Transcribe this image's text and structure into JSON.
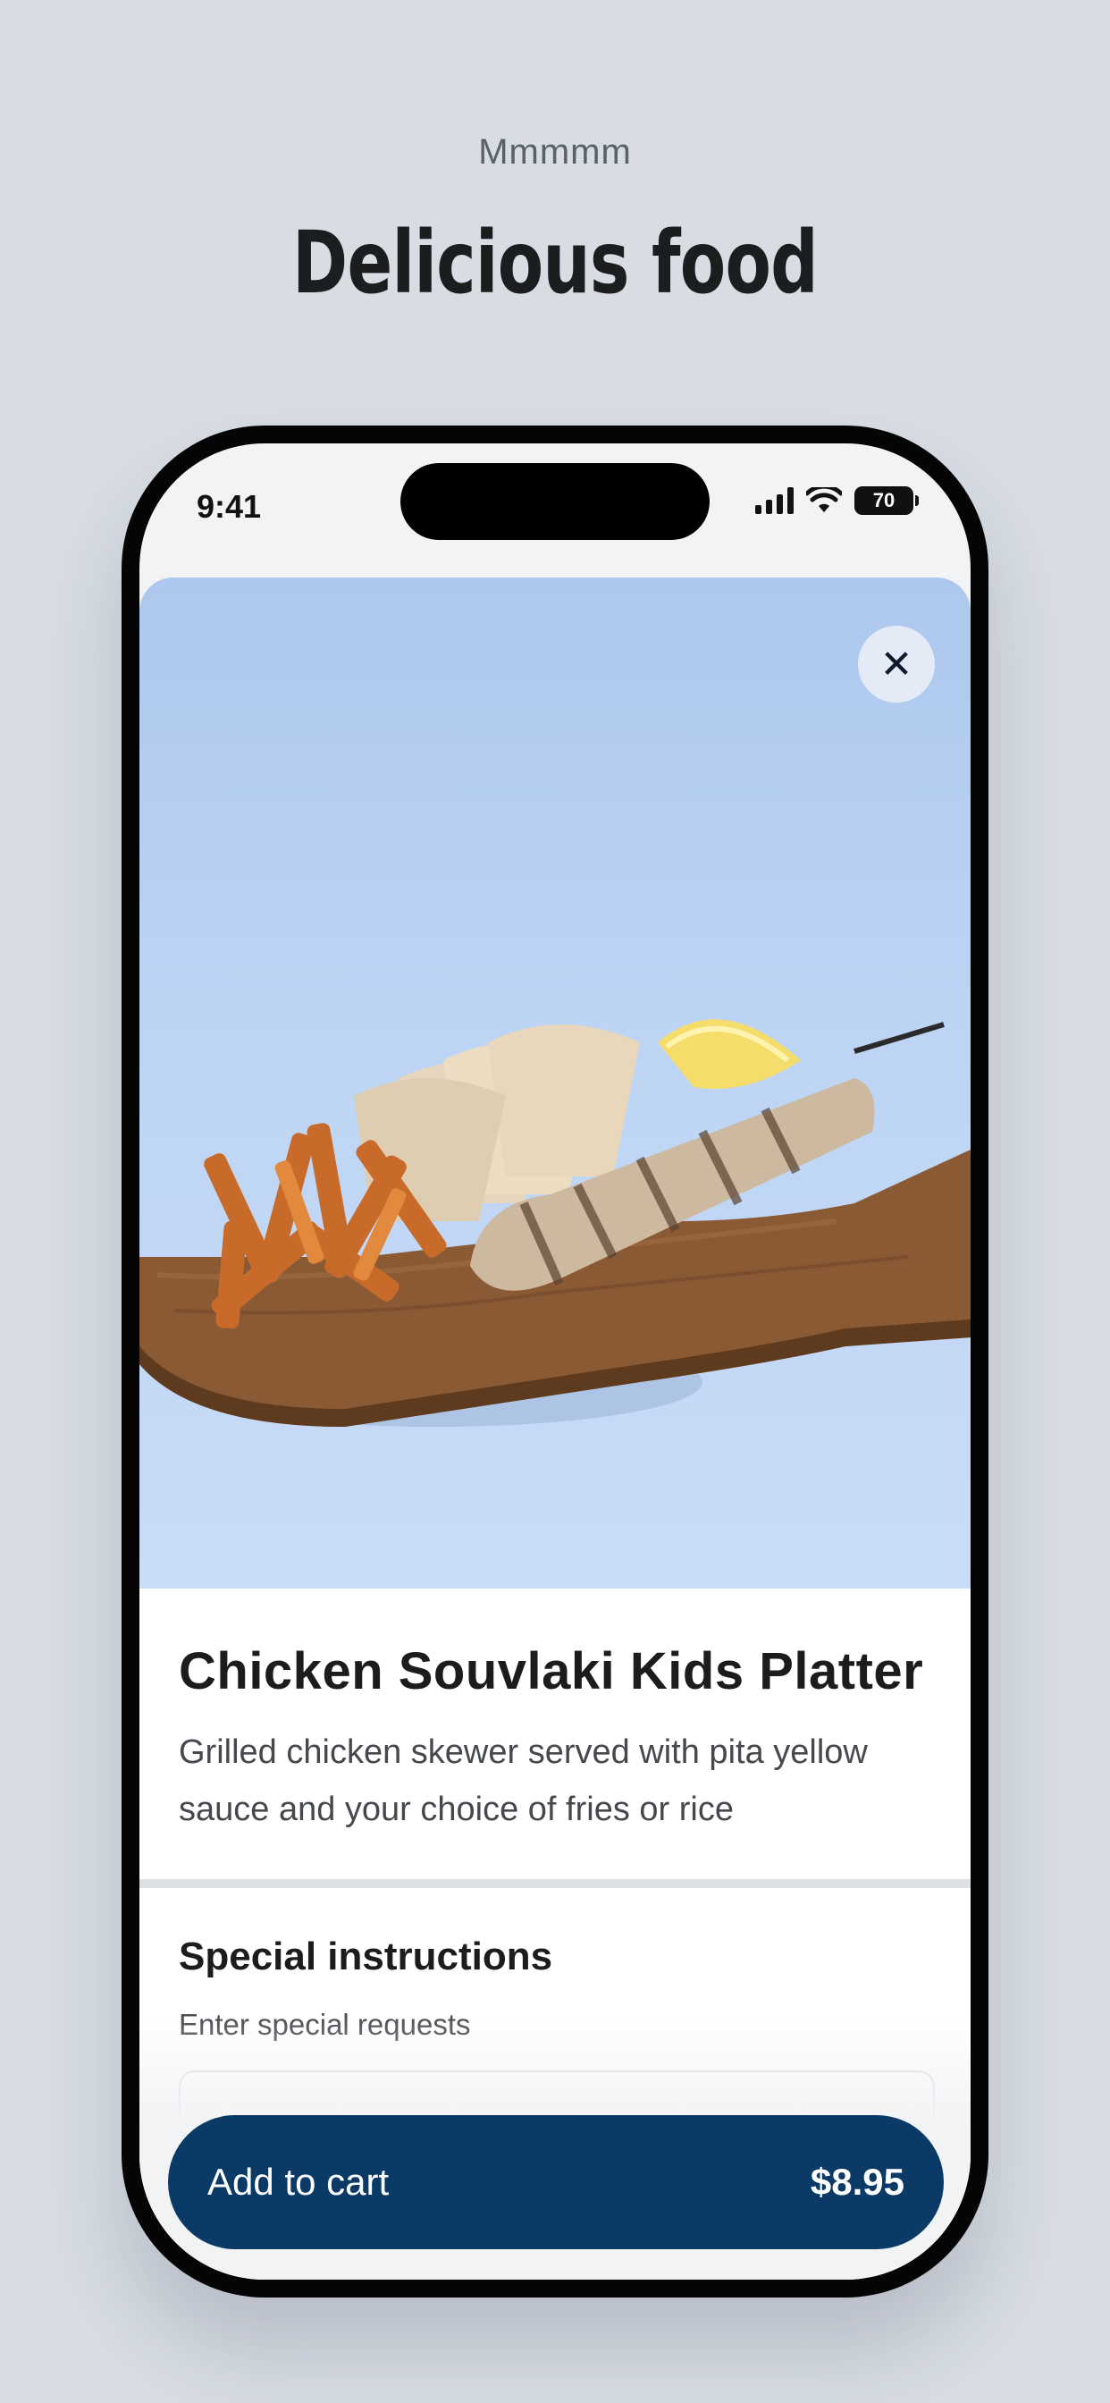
{
  "header": {
    "kicker": "Mmmmm",
    "headline": "Delicious food"
  },
  "status_bar": {
    "time": "9:41",
    "battery": "70"
  },
  "item": {
    "title": "Chicken Souvlaki Kids Platter",
    "description": "Grilled chicken skewer served with pita yellow sauce and your choice of fries or rice"
  },
  "special_instructions": {
    "title": "Special instructions",
    "subtitle": "Enter special requests"
  },
  "cart_button": {
    "label": "Add to cart",
    "price": "$8.95"
  },
  "colors": {
    "page_bg": "#d8dde4",
    "primary": "#0c3a66",
    "hero_bg": "#bdd4f4"
  }
}
